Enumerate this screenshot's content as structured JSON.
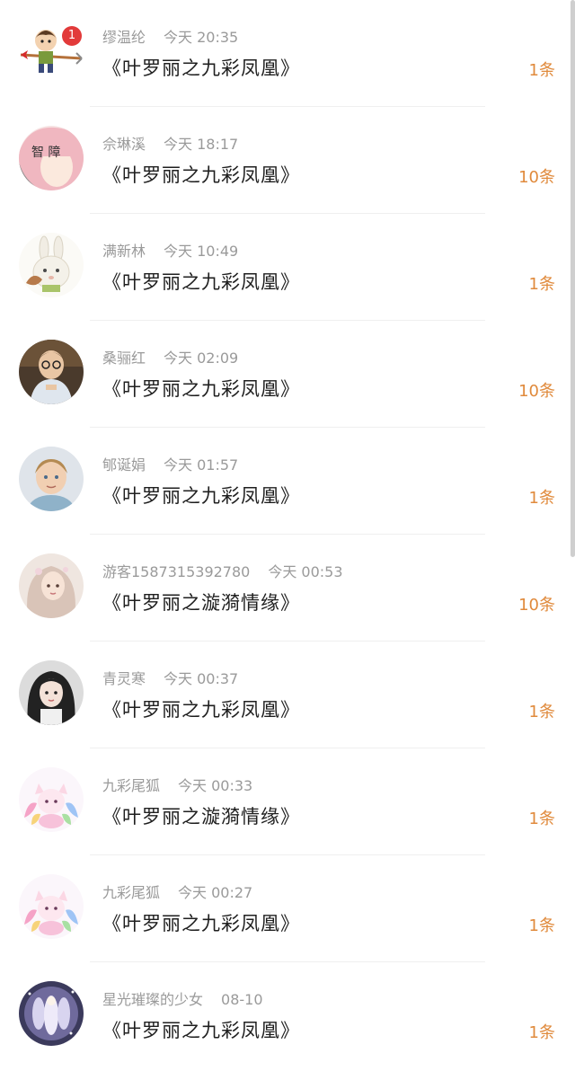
{
  "rows": [
    {
      "name": "缪温纶",
      "time": "今天 20:35",
      "title": "《叶罗丽之九彩凤凰》",
      "count": "1条",
      "badge": "1",
      "avatar": "cartoon-boy"
    },
    {
      "name": "佘琳溪",
      "time": "今天 18:17",
      "title": "《叶罗丽之九彩凤凰》",
      "count": "10条",
      "badge": "",
      "avatar": "pink-hair"
    },
    {
      "name": "满新林",
      "time": "今天 10:49",
      "title": "《叶罗丽之九彩凤凰》",
      "count": "1条",
      "badge": "",
      "avatar": "rabbit"
    },
    {
      "name": "桑骊红",
      "time": "今天 02:09",
      "title": "《叶罗丽之九彩凤凰》",
      "count": "10条",
      "badge": "",
      "avatar": "boy-glasses"
    },
    {
      "name": "郇诞娟",
      "time": "今天 01:57",
      "title": "《叶罗丽之九彩凤凰》",
      "count": "1条",
      "badge": "",
      "avatar": "blond-boy"
    },
    {
      "name": "游客1587315392780",
      "time": "今天 00:53",
      "title": "《叶罗丽之漩漪情缘》",
      "count": "10条",
      "badge": "",
      "avatar": "fantasy-girl"
    },
    {
      "name": "青灵寒",
      "time": "今天 00:37",
      "title": "《叶罗丽之九彩凤凰》",
      "count": "1条",
      "badge": "",
      "avatar": "dark-hair-girl"
    },
    {
      "name": "九彩尾狐",
      "time": "今天 00:33",
      "title": "《叶罗丽之漩漪情缘》",
      "count": "1条",
      "badge": "",
      "avatar": "rainbow-fox"
    },
    {
      "name": "九彩尾狐",
      "time": "今天 00:27",
      "title": "《叶罗丽之九彩凤凰》",
      "count": "1条",
      "badge": "",
      "avatar": "rainbow-fox"
    },
    {
      "name": "星光璀璨的少女",
      "time": "08-10",
      "title": "《叶罗丽之九彩凤凰》",
      "count": "1条",
      "badge": "",
      "avatar": "starlight-girl"
    }
  ],
  "colors": {
    "count": "#e08a3c",
    "meta": "#9a9a9a",
    "title": "#1f1f1f",
    "badge": "#e23a3a"
  }
}
